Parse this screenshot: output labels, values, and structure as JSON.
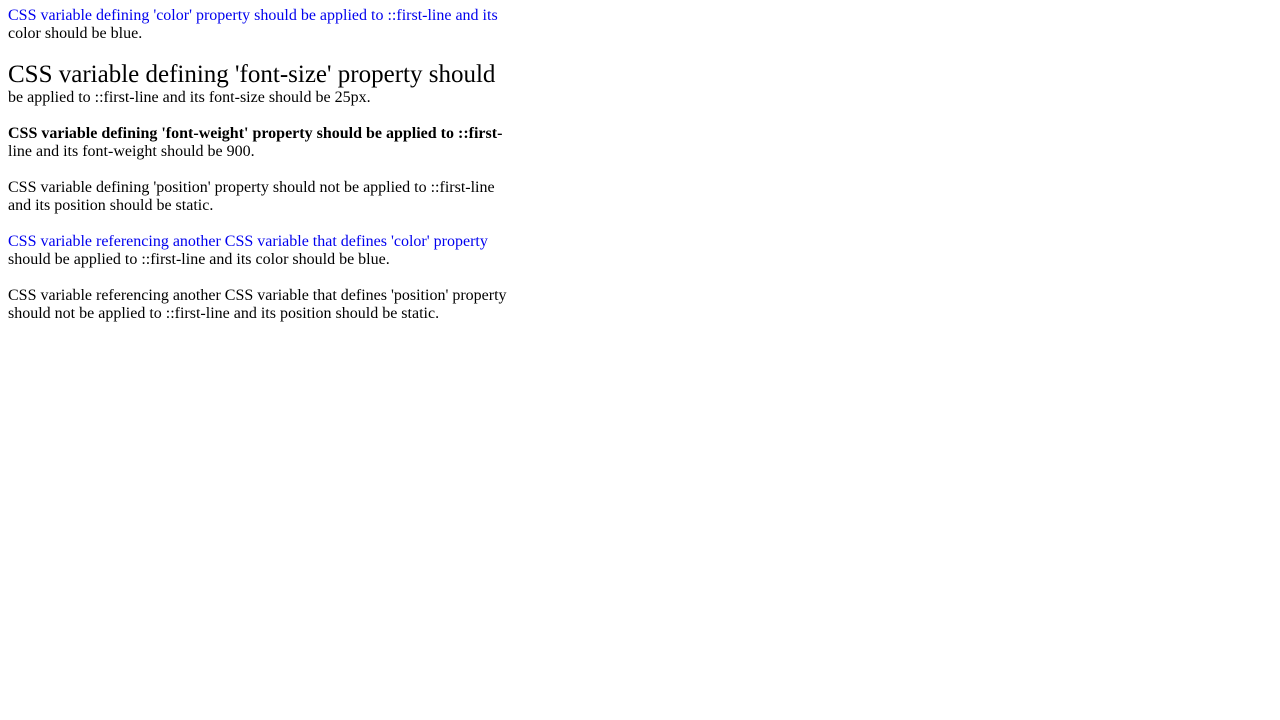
{
  "colors": {
    "accent_blue": "#0000ee",
    "text": "#000000",
    "background": "#ffffff"
  },
  "paragraphs": [
    {
      "first_line": "CSS variable defining 'color' property should be applied to ::first-line and its",
      "rest": "color should be blue."
    },
    {
      "first_line": "CSS variable defining 'font-size' property should",
      "rest": "be applied to ::first-line and its font-size should be 25px."
    },
    {
      "first_line": "CSS variable defining 'font-weight' property should be applied to ::first-",
      "rest": "line and its font-weight should be 900."
    },
    {
      "first_line": "CSS variable defining 'position' property should not be applied to ::first-line",
      "rest": "and its position should be static."
    },
    {
      "first_line": "CSS variable referencing another CSS variable that defines 'color' property",
      "rest": "should be applied to ::first-line and its color should be blue."
    },
    {
      "first_line": "CSS variable referencing another CSS variable that defines 'position' property",
      "rest": "should not be applied to ::first-line and its position should be static."
    }
  ]
}
